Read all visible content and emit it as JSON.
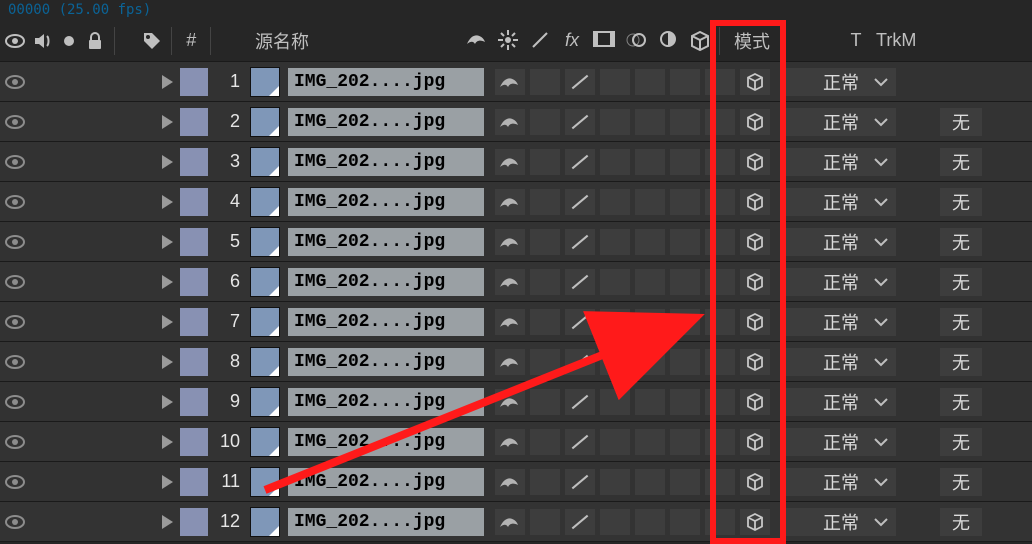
{
  "frame_counter": "00000 (25.00 fps)",
  "header": {
    "visibility": "可见性",
    "audio": "音频",
    "solo": "独奏",
    "lock": "锁定",
    "label": "标签",
    "index": "#",
    "source_name": "源名称",
    "switches": [
      "shy",
      "collapse",
      "quality",
      "fx",
      "frameblend",
      "motionblur",
      "adjustment",
      "3d"
    ],
    "mode": "模式",
    "t_col": "T",
    "trkmat": "TrkM"
  },
  "highlight": {
    "column": "3d-switch",
    "arrow": true
  },
  "layers": [
    {
      "index": 1,
      "name": "IMG_202....jpg",
      "mode": "正常",
      "trkmat": ""
    },
    {
      "index": 2,
      "name": "IMG_202....jpg",
      "mode": "正常",
      "trkmat": "无"
    },
    {
      "index": 3,
      "name": "IMG_202....jpg",
      "mode": "正常",
      "trkmat": "无"
    },
    {
      "index": 4,
      "name": "IMG_202....jpg",
      "mode": "正常",
      "trkmat": "无"
    },
    {
      "index": 5,
      "name": "IMG_202....jpg",
      "mode": "正常",
      "trkmat": "无"
    },
    {
      "index": 6,
      "name": "IMG_202....jpg",
      "mode": "正常",
      "trkmat": "无"
    },
    {
      "index": 7,
      "name": "IMG_202....jpg",
      "mode": "正常",
      "trkmat": "无"
    },
    {
      "index": 8,
      "name": "IMG_202....jpg",
      "mode": "正常",
      "trkmat": "无"
    },
    {
      "index": 9,
      "name": "IMG_202....jpg",
      "mode": "正常",
      "trkmat": "无"
    },
    {
      "index": 10,
      "name": "IMG_202....jpg",
      "mode": "正常",
      "trkmat": "无"
    },
    {
      "index": 11,
      "name": "IMG_202....jpg",
      "mode": "正常",
      "trkmat": "无"
    },
    {
      "index": 12,
      "name": "IMG_202....jpg",
      "mode": "正常",
      "trkmat": "无"
    }
  ]
}
